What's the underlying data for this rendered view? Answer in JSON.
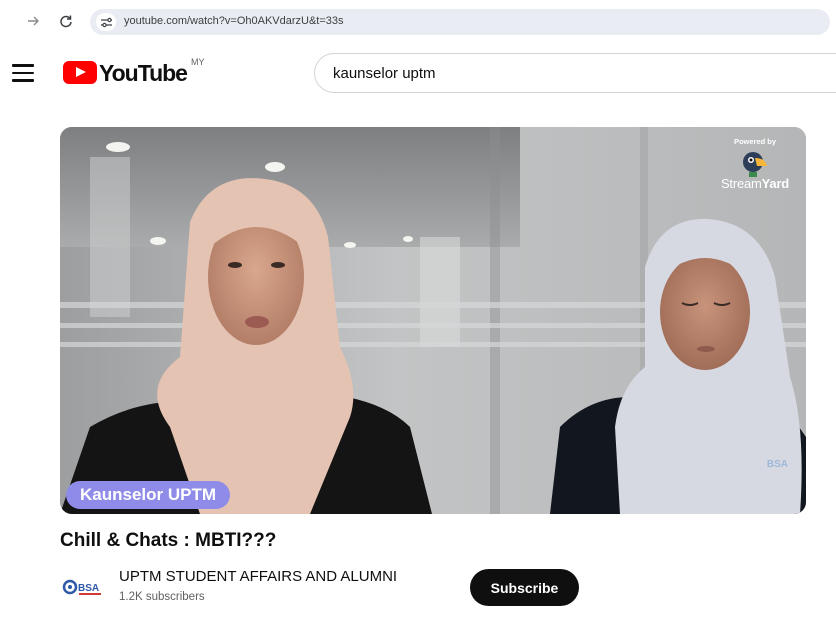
{
  "browser": {
    "url": "youtube.com/watch?v=Oh0AKVdarzU&t=33s"
  },
  "header": {
    "logo_text": "YouTube",
    "country_code": "MY",
    "search_value": "kaunselor uptm"
  },
  "video": {
    "overlay_powered": "Powered by",
    "overlay_brand_a": "Stream",
    "overlay_brand_b": "Yard",
    "name_tag": "Kaunselor UPTM",
    "watermark": "BSA"
  },
  "meta": {
    "title": "Chill & Chats : MBTI???",
    "channel_name": "UPTM STUDENT AFFAIRS AND ALUMNI",
    "subscribers": "1.2K subscribers",
    "subscribe_label": "Subscribe",
    "channel_logo_text": "BSA"
  },
  "icons": [
    "back-arrow-icon",
    "reload-icon",
    "site-settings-icon",
    "menu-icon",
    "youtube-logo-icon",
    "streamyard-duck-icon"
  ],
  "colors": {
    "youtube_red": "#ff0000",
    "name_tag": "#8f8be8",
    "subscribe_bg": "#0f0f0f",
    "address_bar": "#e9edf3"
  }
}
